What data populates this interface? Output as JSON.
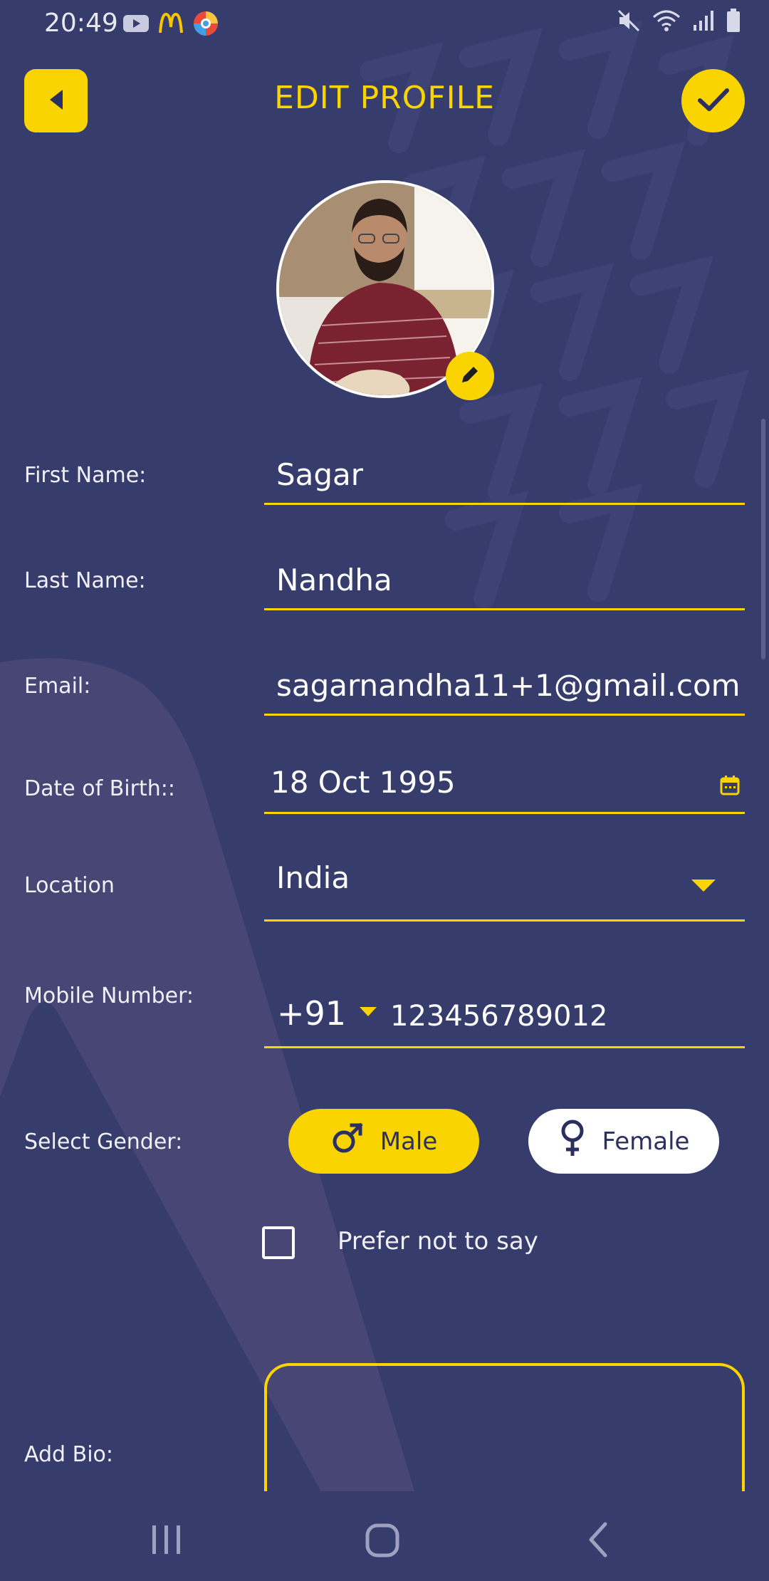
{
  "status_bar": {
    "time": "20:49",
    "left_icons": [
      "youtube-icon",
      "mcdonalds-icon",
      "browser-icon"
    ],
    "right_icons": [
      "mute-icon",
      "wifi-icon",
      "signal-icon",
      "battery-icon"
    ]
  },
  "header": {
    "title": "EDIT PROFILE",
    "back_icon": "caret-left-icon",
    "save_icon": "check-icon"
  },
  "avatar": {
    "edit_icon": "pencil-icon"
  },
  "form": {
    "first_name": {
      "label": "First Name:",
      "value": "Sagar"
    },
    "last_name": {
      "label": "Last Name:",
      "value": "Nandha"
    },
    "email": {
      "label": "Email:",
      "value": "sagarnandha11+1@gmail.com"
    },
    "dob": {
      "label": "Date of Birth::",
      "value": "18 Oct 1995",
      "icon": "calendar-icon"
    },
    "location": {
      "label": "Location",
      "value": "India",
      "icon": "dropdown-arrow-icon"
    },
    "mobile": {
      "label": "Mobile Number:",
      "country_code": "+91",
      "value": "123456789012"
    },
    "gender": {
      "label": "Select Gender:",
      "options": [
        "Male",
        "Female"
      ],
      "selected": "Male"
    },
    "prefer_not": {
      "label": "Prefer not to say",
      "checked": false
    },
    "bio": {
      "label": "Add Bio:",
      "value": ""
    }
  },
  "colors": {
    "background": "#363c6c",
    "accent": "#f9d400",
    "text": "#ffffff"
  },
  "nav_bar": {
    "items": [
      "recent-apps-icon",
      "home-icon",
      "back-icon"
    ]
  }
}
